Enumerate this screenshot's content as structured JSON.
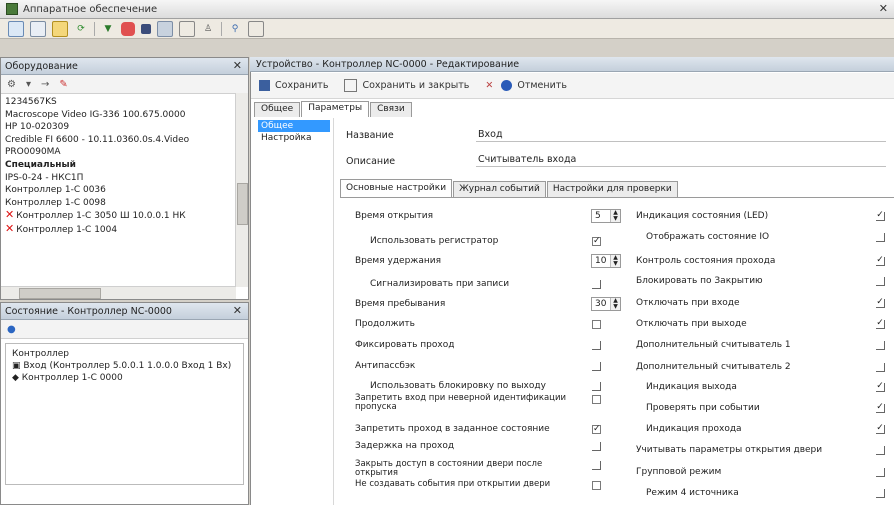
{
  "window": {
    "title": "Аппаратное обеспечение"
  },
  "left_top": {
    "title": "Оборудование",
    "tree": [
      {
        "label": "1234567KS",
        "bold": false,
        "error": false
      },
      {
        "label": "Macroscope Video IG-336 100.675.0000",
        "bold": false,
        "error": false
      },
      {
        "label": "HP 10-020309",
        "bold": false,
        "error": false
      },
      {
        "label": "Credible FI 6600 - 10.11.0360.0s.4.Video",
        "bold": false,
        "error": false
      },
      {
        "label": "PRO0090MA",
        "bold": false,
        "error": false
      },
      {
        "label": "Специальный",
        "bold": true,
        "error": false
      },
      {
        "label": "IPS-0-24 - НКС1П",
        "bold": false,
        "error": false
      },
      {
        "label": "Контроллер 1-С 0036",
        "bold": false,
        "error": false
      },
      {
        "label": "Контроллер 1-С 0098",
        "bold": false,
        "error": false
      },
      {
        "label": "Контроллер 1-С 3050 Ш 10.0.0.1 НК",
        "bold": false,
        "error": true
      },
      {
        "label": "Контроллер 1-С 1004",
        "bold": false,
        "error": true
      }
    ]
  },
  "left_bottom": {
    "title": "Состояние - Контроллер NC-0000",
    "section": "Контроллер",
    "rows": [
      "Вход (Контроллер 5.0.0.1 1.0.0.0 Вход 1 Вх)",
      "Контроллер 1-С 0000"
    ]
  },
  "main": {
    "header": "Устройство - Контроллер NC-0000 - Редактирование",
    "toolbar": {
      "save": "Сохранить",
      "save_close": "Сохранить и закрыть",
      "cancel": "Отменить"
    },
    "subtabs": [
      "Общее",
      "Параметры",
      "Связи"
    ],
    "sidelist": [
      "Общее",
      "Настройка"
    ],
    "name_label": "Название",
    "name_value": "Вход",
    "type_label": "Описание",
    "type_value": "Считыватель входа",
    "prop_tabs": [
      "Основные настройки",
      "Журнал событий",
      "Настройки для проверки"
    ],
    "left_rows": [
      {
        "label": "Время открытия",
        "ctrl": "spin",
        "value": "5"
      },
      {
        "label": "Использовать регистратор",
        "ctrl": "check",
        "checked": true,
        "indent": true
      },
      {
        "label": "Время удержания",
        "ctrl": "spin",
        "value": "10"
      },
      {
        "label": "Сигнализировать при записи",
        "ctrl": "thin",
        "indent": true
      },
      {
        "label": "Время пребывания",
        "ctrl": "spin",
        "value": "30"
      },
      {
        "label": "Продолжить",
        "ctrl": "check",
        "checked": false
      },
      {
        "label": "Фиксировать проход",
        "ctrl": "thin"
      },
      {
        "label": "Антипассбэк",
        "ctrl": "thin"
      },
      {
        "label": "Использовать блокировку по выходу",
        "ctrl": "thin",
        "indent": true
      },
      {
        "label": "Запретить вход при неверной идентификации пропуска",
        "ctrl": "check",
        "checked": false,
        "small": true
      },
      {
        "label": "Запретить проход в заданное состояние",
        "ctrl": "check",
        "checked": true
      },
      {
        "label": "Задержка на проход",
        "ctrl": "thin"
      },
      {
        "label": "Закрыть доступ в состоянии двери после открытия",
        "ctrl": "thin",
        "small": true
      },
      {
        "label": "Не создавать события при открытии двери",
        "ctrl": "check",
        "checked": false,
        "small": true
      }
    ],
    "right_rows": [
      {
        "label": "Индикация состояния (LED)",
        "checked": true
      },
      {
        "label": "Отображать состояние IO",
        "checked": false,
        "indent": true
      },
      {
        "label": "Контроль состояния прохода",
        "checked": true
      },
      {
        "label": "Блокировать по Закрытию",
        "checked": false
      },
      {
        "label": "Отключать при входе",
        "checked": true
      },
      {
        "label": "Отключать при выходе",
        "checked": true
      },
      {
        "label": "Дополнительный считыватель 1",
        "checked": false
      },
      {
        "label": "Дополнительный считыватель 2",
        "checked": false
      },
      {
        "label": "Индикация выхода",
        "checked": true,
        "indent": true
      },
      {
        "label": "Проверять при событии",
        "checked": true,
        "indent": true
      },
      {
        "label": "Индикация прохода",
        "checked": true,
        "indent": true
      },
      {
        "label": "Учитывать параметры открытия двери",
        "checked": false
      },
      {
        "label": "Групповой режим",
        "checked": false
      },
      {
        "label": "Режим 4 источника",
        "checked": false,
        "indent": true
      }
    ]
  },
  "colors": {
    "selection": "#3399ff",
    "error": "#dd1111",
    "panel_header": "#c4cfdb"
  }
}
